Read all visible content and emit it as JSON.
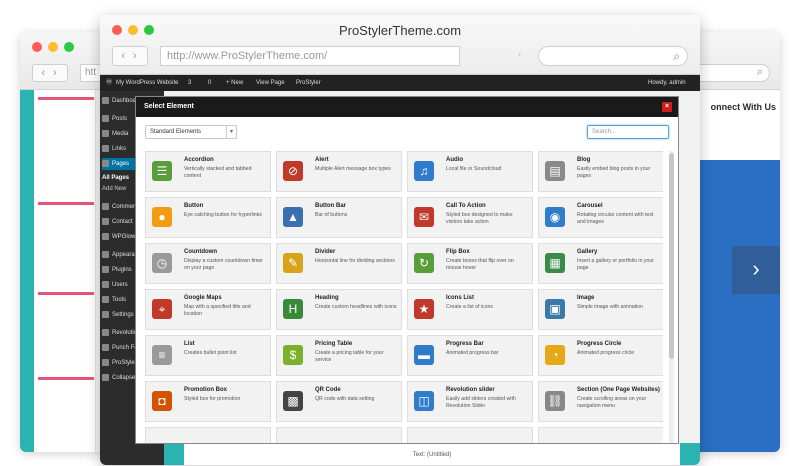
{
  "back_window": {
    "title": "",
    "right_heading": "onnect With Us",
    "url_prefix": "htt",
    "next_arrow": "›"
  },
  "front_window": {
    "title": "ProStylerTheme.com",
    "url": "http://www.ProStylerTheme.com/"
  },
  "admin_bar": {
    "site": "My WordPress Website",
    "updates": "3",
    "comments": "0",
    "new": "+ New",
    "view": "View Page",
    "plugin": "ProStyler",
    "howdy": "Howdy, admin"
  },
  "sidebar": {
    "items": [
      "Dashboard",
      "Posts",
      "Media",
      "Links",
      "Pages",
      "Comments",
      "Contact",
      "WPGlow",
      "Appearance",
      "Plugins",
      "Users",
      "Tools",
      "Settings",
      "Revolution",
      "Punch Fo",
      "ProStyler",
      "Collapse m"
    ],
    "sub": [
      "All Pages",
      "Add New"
    ]
  },
  "bottom": {
    "text_untitled": "Text: (Untitled)"
  },
  "modal": {
    "title": "Select Element",
    "close": "×",
    "filter_value": "Standard Elements",
    "search_placeholder": "Search...",
    "elements": [
      {
        "title": "Accordion",
        "desc": "Vertically stacked and tabbed content",
        "icon": "accordion-icon",
        "color": "#5a9e3b",
        "glyph": "☰"
      },
      {
        "title": "Alert",
        "desc": "Multiple Alert message box types",
        "icon": "alert-icon",
        "color": "#c0392b",
        "glyph": "⊘"
      },
      {
        "title": "Audio",
        "desc": "Local file or Soundcloud",
        "icon": "audio-icon",
        "color": "#2f7ccb",
        "glyph": "♫"
      },
      {
        "title": "Blog",
        "desc": "Easily embed blog posts in your pages",
        "icon": "blog-icon",
        "color": "#8a8a8a",
        "glyph": "▤"
      },
      {
        "title": "Button",
        "desc": "Eye catching button for hyperlinks",
        "icon": "button-icon",
        "color": "#f39c12",
        "glyph": "●"
      },
      {
        "title": "Button Bar",
        "desc": "Bar of buttons",
        "icon": "button-bar-icon",
        "color": "#3a6fb0",
        "glyph": "▲"
      },
      {
        "title": "Call To Action",
        "desc": "Styled box designed to make visitors take action",
        "icon": "call-to-action-icon",
        "color": "#c0392b",
        "glyph": "✉"
      },
      {
        "title": "Carousel",
        "desc": "Rotating circular content with text and images",
        "icon": "carousel-icon",
        "color": "#2f7ccb",
        "glyph": "◉"
      },
      {
        "title": "Countdown",
        "desc": "Display a custom countdown timer on your page",
        "icon": "countdown-icon",
        "color": "#9a9a9a",
        "glyph": "◷"
      },
      {
        "title": "Divider",
        "desc": "Horizontal line for dividing sections",
        "icon": "divider-icon",
        "color": "#d9a21b",
        "glyph": "✎"
      },
      {
        "title": "Flip Box",
        "desc": "Create boxes that flip over on mouse hover",
        "icon": "flip-box-icon",
        "color": "#5a9e3b",
        "glyph": "↻"
      },
      {
        "title": "Gallery",
        "desc": "Insert a gallery or portfolio in your page",
        "icon": "gallery-icon",
        "color": "#3a8a4a",
        "glyph": "▦"
      },
      {
        "title": "Google Maps",
        "desc": "Map with a specified title and location",
        "icon": "google-maps-icon",
        "color": "#c0392b",
        "glyph": "⌖"
      },
      {
        "title": "Heading",
        "desc": "Create custom headlines with icons",
        "icon": "heading-icon",
        "color": "#3a8a3a",
        "glyph": "H"
      },
      {
        "title": "Icons List",
        "desc": "Create a list of icons",
        "icon": "icons-list-icon",
        "color": "#c0392b",
        "glyph": "★"
      },
      {
        "title": "Image",
        "desc": "Simple image with animation",
        "icon": "image-icon",
        "color": "#3a7aaa",
        "glyph": "▣"
      },
      {
        "title": "List",
        "desc": "Creates bullet point list",
        "icon": "list-icon",
        "color": "#9a9a9a",
        "glyph": "≡"
      },
      {
        "title": "Pricing Table",
        "desc": "Create a pricing table for your service",
        "icon": "pricing-table-icon",
        "color": "#7ab02c",
        "glyph": "$"
      },
      {
        "title": "Progress Bar",
        "desc": "Animated progress bar",
        "icon": "progress-bar-icon",
        "color": "#2f7ccb",
        "glyph": "▬"
      },
      {
        "title": "Progress Circle",
        "desc": "Animated progress circle",
        "icon": "progress-circle-icon",
        "color": "#e6a817",
        "glyph": "◔"
      },
      {
        "title": "Promotion Box",
        "desc": "Styled box for promotion",
        "icon": "promotion-box-icon",
        "color": "#d35400",
        "glyph": "◘"
      },
      {
        "title": "QR Code",
        "desc": "QR code with data setting",
        "icon": "qr-code-icon",
        "color": "#444444",
        "glyph": "▩"
      },
      {
        "title": "Revolution slider",
        "desc": "Easily add sliders created with Revolution Slider",
        "icon": "revolution-slider-icon",
        "color": "#2f7ccb",
        "glyph": "◫"
      },
      {
        "title": "Section (One Page Websites)",
        "desc": "Create scrolling areas on your navigation menu",
        "icon": "section-icon",
        "color": "#888888",
        "glyph": "⛓"
      }
    ]
  }
}
